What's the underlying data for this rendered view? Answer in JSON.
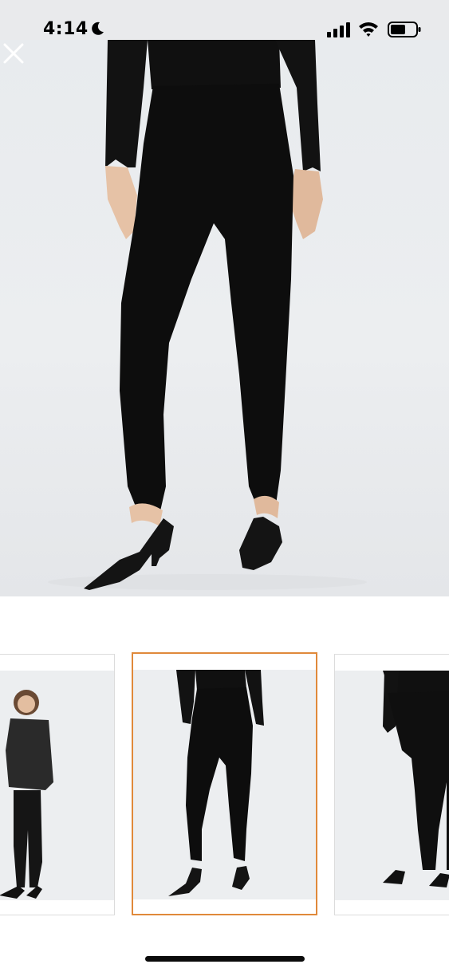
{
  "status_bar": {
    "time": "4:14",
    "icons": [
      "moon-icon",
      "cellular-signal-icon",
      "wifi-icon",
      "battery-icon"
    ]
  },
  "viewer": {
    "close_icon": "close-icon",
    "main_image_alt": "",
    "selected_thumbnail": 1,
    "thumbnail_count": 3
  },
  "colors": {
    "selected_border": "#e0893a",
    "background": "#ffffff",
    "status_bar_bg": "#e9eaec"
  }
}
